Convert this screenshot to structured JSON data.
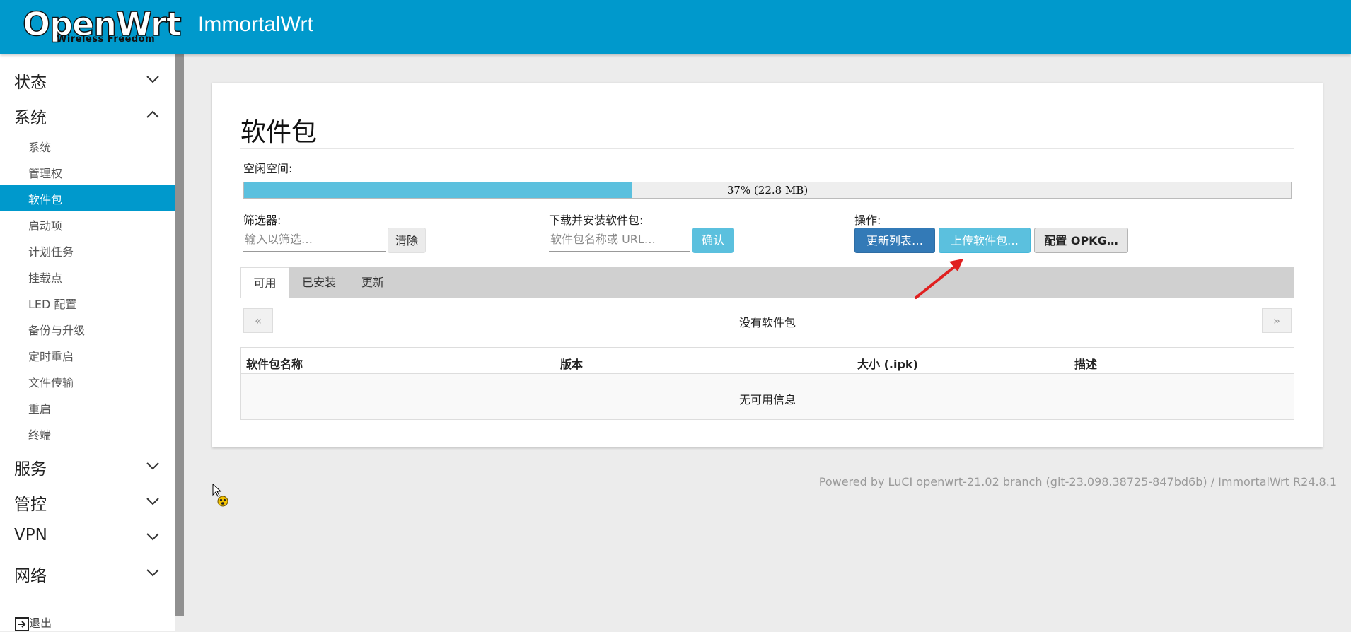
{
  "header": {
    "logo_text": "OpenWrt",
    "logo_tagline": "Wireless Freedom",
    "hostname": "ImmortalWrt"
  },
  "sidebar": {
    "menus": [
      {
        "label": "状态",
        "expanded": false
      },
      {
        "label": "系统",
        "expanded": true
      },
      {
        "label": "服务",
        "expanded": false
      },
      {
        "label": "管控",
        "expanded": false
      },
      {
        "label": "VPN",
        "expanded": false
      },
      {
        "label": "网络",
        "expanded": false
      }
    ],
    "system_items": [
      "系统",
      "管理权",
      "软件包",
      "启动项",
      "计划任务",
      "挂载点",
      "LED 配置",
      "备份与升级",
      "定时重启",
      "文件传输",
      "重启",
      "终端"
    ],
    "active_item": "软件包",
    "logout": "退出"
  },
  "page": {
    "title": "软件包",
    "free_space_label": "空闲空间:",
    "free_space_percent": 37,
    "free_space_text": "37% (22.8 MB)",
    "filter": {
      "label": "筛选器:",
      "placeholder": "输入以筛选…",
      "clear_label": "清除"
    },
    "download": {
      "label": "下载并安装软件包:",
      "placeholder": "软件包名称或 URL…",
      "confirm_label": "确认"
    },
    "actions": {
      "label": "操作:",
      "update_list": "更新列表…",
      "upload": "上传软件包…",
      "configure": "配置 OPKG…"
    },
    "tabs": [
      "可用",
      "已安装",
      "更新"
    ],
    "active_tab": "可用",
    "pager": {
      "prev": "«",
      "next": "»",
      "status": "没有软件包"
    },
    "table": {
      "headers": [
        "软件包名称",
        "版本",
        "大小 (.ipk)",
        "描述"
      ],
      "empty_text": "无可用信息"
    }
  },
  "footer": {
    "text": "Powered by LuCI openwrt-21.02 branch (git-23.098.38725-847bd6b) / ImmortalWrt R24.8.1"
  },
  "colors": {
    "header": "#0099cc",
    "active_menu": "#0099cc",
    "progress_fill": "#5bc0de",
    "primary_button": "#337ab7",
    "info_button": "#5bc0de",
    "annotation_arrow": "#e02020"
  },
  "icons": {
    "chevron_collapsed": "chevron-down-icon",
    "chevron_expanded": "chevron-up-icon",
    "logout": "logout-icon"
  }
}
